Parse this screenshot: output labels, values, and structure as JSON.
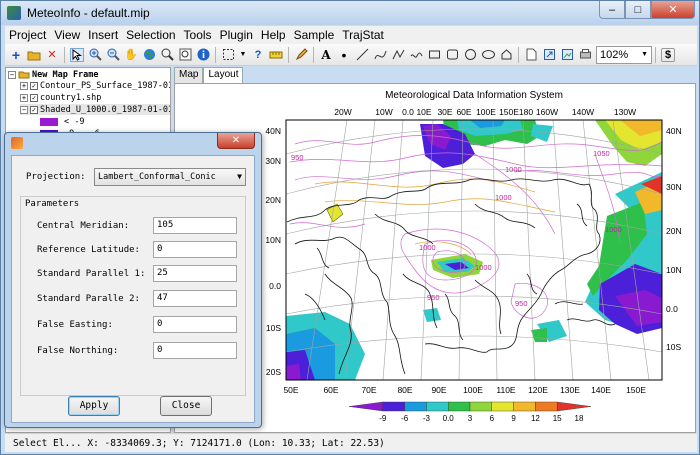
{
  "window": {
    "title": "MeteoInfo - default.mip",
    "min_glyph": "–",
    "max_glyph": "□",
    "close_glyph": "✕"
  },
  "menu": [
    "Project",
    "View",
    "Insert",
    "Selection",
    "Tools",
    "Plugin",
    "Help",
    "Sample",
    "TrajStat"
  ],
  "toolbar": {
    "tools": [
      "add-layer",
      "open",
      "remove",
      "select",
      "zoom-in",
      "zoom-out",
      "pan",
      "full-extent",
      "zoom-layer",
      "zoom-select",
      "identify",
      "select-features",
      "help",
      "measure",
      "label",
      "text",
      "point",
      "line",
      "curve",
      "polyline",
      "polygon",
      "rectangle",
      "circle",
      "ellipse",
      "shape",
      "new-layout",
      "export",
      "save",
      "print"
    ],
    "zoom": "102%",
    "dollar_glyph": "$"
  },
  "legend": {
    "frame": "New Map Frame",
    "layers": [
      "Contour_PS_Surface_1987-01-",
      "country1.shp",
      "Shaded_U_1000.0_1987-01-01"
    ],
    "items": [
      {
        "label": "< -9",
        "color": "#9a1ad0"
      },
      {
        "label": "-9 - -6",
        "color": "#4a14cc"
      }
    ]
  },
  "tabs": [
    "Map",
    "Layout"
  ],
  "map": {
    "title": "Meteorological Data Information System",
    "top_labels": [
      "20W",
      "10W",
      "0.0",
      "10E",
      "30E",
      "60E",
      "100E",
      "150E",
      "180",
      "160W",
      "140W",
      "130W"
    ],
    "bottom_labels": [
      "50E",
      "60E",
      "70E",
      "80E",
      "90E",
      "100E",
      "110E",
      "120E",
      "130E",
      "140E",
      "150E"
    ],
    "left_labels": [
      "40N",
      "30N",
      "20N",
      "10N",
      "0.0",
      "10S",
      "20S"
    ],
    "right_labels": [
      "40N",
      "30N",
      "20N",
      "10N",
      "0.0",
      "10S"
    ],
    "contour_labels": [
      "950",
      "1000",
      "1000",
      "1050",
      "950",
      "1000",
      "1000",
      "950",
      "1000"
    ],
    "colorbar_labels": [
      "-9",
      "-6",
      "-3",
      "0.0",
      "3",
      "6",
      "9",
      "12",
      "15",
      "18"
    ],
    "colorbar_colors": [
      "#8a1ad0",
      "#4c20d8",
      "#1a9be0",
      "#30c8c8",
      "#2fbf4b",
      "#8ed63a",
      "#e3e52f",
      "#f0b82a",
      "#ee7a24",
      "#e1332a"
    ]
  },
  "status": {
    "text": "Select El...   X: -8334069.3; Y: 7124171.0 (Lon: 10.33; Lat: 22.53)"
  },
  "dialog": {
    "close_glyph": "✕",
    "projection_label": "Projection:",
    "projection_value": "Lambert_Conformal_Conic",
    "dropdown_glyph": "▼",
    "group_title": "Parameters",
    "params": [
      {
        "label": "Central Meridian:",
        "value": "105"
      },
      {
        "label": "Reference Latitude:",
        "value": "0"
      },
      {
        "label": "Standard Parallel 1:",
        "value": "25"
      },
      {
        "label": "Standard Paralle 2:",
        "value": "47"
      },
      {
        "label": "False Easting:",
        "value": "0"
      },
      {
        "label": "False Northing:",
        "value": "0"
      }
    ],
    "apply": "Apply",
    "close": "Close"
  }
}
